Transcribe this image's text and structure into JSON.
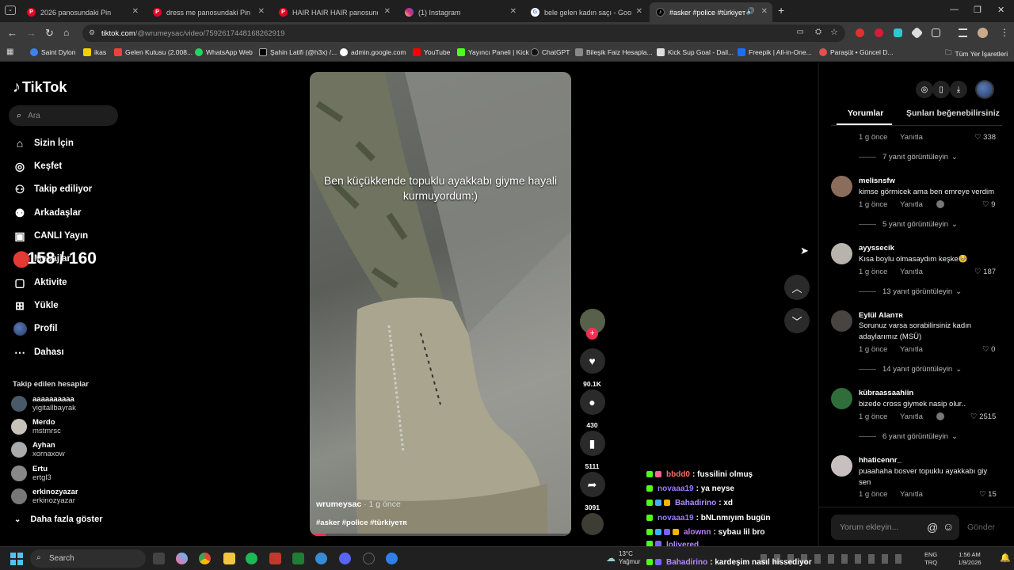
{
  "browser": {
    "tabs": [
      {
        "label": "2026 panosundaki Pin",
        "color": "#e60023"
      },
      {
        "label": "dress me panosundaki Pin",
        "color": "#e60023"
      },
      {
        "label": "HAIR HAIR HAIR panosundaki Pin",
        "color": "#e60023"
      },
      {
        "label": "(1) Instagram",
        "color": "#d62976"
      },
      {
        "label": "bele gelen kadın saçı - Google Search",
        "color": "#4285f4"
      },
      {
        "label": "#asker #police #türkiyeᴛʀ |",
        "color": "#000000"
      }
    ],
    "url_host": "tiktok.com",
    "url_path": "/@wrumeysac/video/7592617448168262919",
    "bookmarks": [
      "Saint Dylon",
      "ikas",
      "Gelen Kutusu (2.008...",
      "WhatsApp Web",
      "Şahin Latifi (@h3x) /...",
      "admin.google.com",
      "YouTube",
      "Yayıncı Paneli | Kick",
      "ChatGPT",
      "Bileşik Faiz Hesapla...",
      "Kick Sup Goal - Dail...",
      "Freepik | All-in-One...",
      "Paraşüt • Güncel D..."
    ],
    "all_bookmarks": "Tüm Yer İşaretleri"
  },
  "sidebar": {
    "logo": "TikTok",
    "search_placeholder": "Ara",
    "nav": [
      "Sizin İçin",
      "Keşfet",
      "Takip ediliyor",
      "Arkadaşlar",
      "CANLI Yayın",
      "Mesajlar",
      "Aktivite",
      "Yükle",
      "Profil",
      "Dahası"
    ],
    "following_title": "Takip edilen hesaplar",
    "accounts": [
      {
        "name": "aaaaaaaaaa",
        "user": "yigitallbayrak"
      },
      {
        "name": "Merdo",
        "user": "mstmrsc"
      },
      {
        "name": "Ayhan",
        "user": "xornaxow"
      },
      {
        "name": "Ertu",
        "user": "ertgl3"
      },
      {
        "name": "erkinozyazar",
        "user": "erkinozyazar"
      }
    ],
    "show_more": "Daha fazla göster"
  },
  "overlay_counter": "158 / 160",
  "video": {
    "caption": "Ben küçükkende topuklu ayakkabı giyme hayali kurmuyordum:)",
    "author": "wrumeysac",
    "time": " · 1 g önce",
    "tags": "#asker #police #türkiyeᴛʀ",
    "progress": 0.06
  },
  "actions": {
    "likes": "90.1K",
    "comments": "430",
    "saves": "5111",
    "shares": "3091"
  },
  "chat": [
    {
      "user": "bbdd0",
      "msg": ": fussilini olmuş",
      "color": "#ff6b6b"
    },
    {
      "user": "novaaa19",
      "msg": ": ya neyse",
      "color": "#9b7bff"
    },
    {
      "user": "Bahadirino",
      "msg": ": xd",
      "color": "#b08cff"
    },
    {
      "user": "novaaa19",
      "msg": ": bNLnmıyım bugün",
      "color": "#9b7bff"
    },
    {
      "user": "alownn",
      "msg": ": sybau lil bro",
      "color": "#c77dff"
    },
    {
      "user": "lolivered",
      "msg": "",
      "color": "#b08cff"
    },
    {
      "user": "Bahadirino",
      "msg": ": kardeşim nasıl hissediyor",
      "color": "#b08cff"
    }
  ],
  "comments_panel": {
    "tab_comments": "Yorumlar",
    "tab_recommend": "Şunları beğenebilirsiniz",
    "first_replies": "7 yanıt görüntüleyin",
    "partial_meta": {
      "time": "1 g önce",
      "reply": "Yanıtla",
      "likes": "338"
    },
    "comments": [
      {
        "name": "melisnsfw",
        "text": "kimse görmicek ama ben emreye verdim",
        "time": "1 g önce",
        "reply": "Yanıtla",
        "likes": "9",
        "replies": "5 yanıt görüntüleyin"
      },
      {
        "name": "ayyssecik",
        "text": "Kısa boylu olmasaydım keşke🥹",
        "time": "1 g önce",
        "reply": "Yanıtla",
        "likes": "187",
        "replies": "13 yanıt görüntüleyin"
      },
      {
        "name": "Eylül Alanᴛʀ",
        "text": "Sorunuz varsa sorabilirsiniz kadın adaylarımız (MSÜ)",
        "time": "1 g önce",
        "reply": "Yanıtla",
        "likes": "0",
        "replies": "14 yanıt görüntüleyin"
      },
      {
        "name": "kübraassaahiin",
        "text": "bizede cross giymek nasip olur..",
        "time": "1 g önce",
        "reply": "Yanıtla",
        "likes": "2515",
        "replies": "6 yanıt görüntüleyin"
      },
      {
        "name": "hhaticennr_",
        "text": "puaahaha bosver topuklu ayakkabı giy sen",
        "time": "1 g önce",
        "reply": "Yanıtla",
        "likes": "15",
        "replies": ""
      }
    ],
    "input_placeholder": "Yorum ekleyin...",
    "send": "Gönder"
  },
  "taskbar": {
    "search": "Search",
    "weather_temp": "13°C",
    "weather_desc": "Yağmur",
    "lang1": "ENG",
    "lang2": "TRQ",
    "time": "1:56 AM",
    "date": "1/9/2026"
  }
}
